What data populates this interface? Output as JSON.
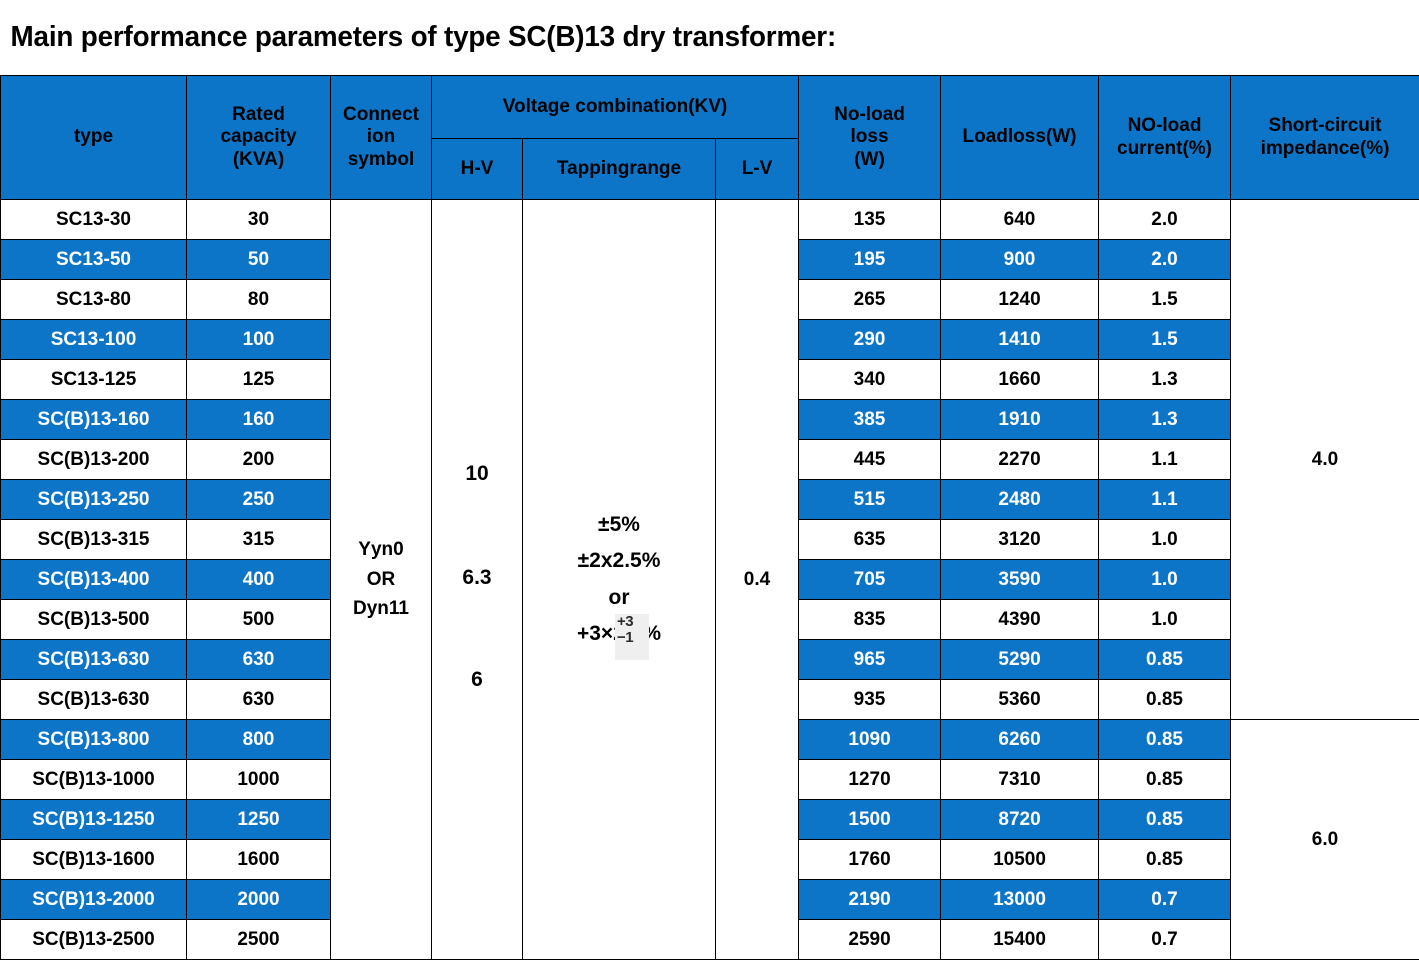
{
  "title": "Main performance parameters of type SC(B)13 dry transformer:",
  "colors": {
    "accent_blue": "#0C75C8",
    "text_dark": "#000000",
    "text_light": "#FFFFFF",
    "grid_line": "#000000",
    "marker_bg": "#EFEFEF"
  },
  "header": {
    "type": "type",
    "rated_capacity": "Rated capacity (KVA)",
    "rated_capacity_lines": [
      "Rated",
      "capacity",
      "(KVA)"
    ],
    "connection_symbol": "Connection symbol",
    "connection_symbol_lines": [
      "Connect",
      "ion",
      "symbol"
    ],
    "voltage_combination": "Voltage combination(KV)",
    "hv": "H-V",
    "tapping_range": "Tappingrange",
    "lv": "L-V",
    "no_load_loss": "No-load loss (W)",
    "no_load_loss_lines": [
      "No-load",
      "loss",
      "(W)"
    ],
    "load_loss": "Loadloss(W)",
    "no_load_current": "NO-load current(%)",
    "no_load_current_lines": [
      "NO-load",
      "current(%)"
    ],
    "short_circuit_impedance": "Short-circuit impedance(%)",
    "short_circuit_impedance_lines": [
      "Short-circuit",
      "impedance(%)"
    ]
  },
  "merged": {
    "connection_symbol_value": "Yyn0 OR Dyn11",
    "connection_symbol_value_lines": [
      "Yyn0",
      "OR",
      "Dyn11"
    ],
    "hv_values": [
      "10",
      "6.3",
      "6"
    ],
    "tapping_range_lines": [
      "±5%",
      "±2x2.5%",
      "or",
      "+3×2.5%"
    ],
    "tapping_marker_upper": "+3",
    "tapping_marker_lower": "−1",
    "lv_value": "0.4",
    "short_circuit_impedance_group_1": "4.0",
    "short_circuit_impedance_group_2": "6.0",
    "short_circuit_group_1_rows": 13,
    "short_circuit_group_2_rows": 7
  },
  "rows": [
    {
      "type": "SC13-30",
      "capacity": "30",
      "no_load_loss": "135",
      "load_loss": "640",
      "no_load_current": "2.0",
      "shaded": false
    },
    {
      "type": "SC13-50",
      "capacity": "50",
      "no_load_loss": "195",
      "load_loss": "900",
      "no_load_current": "2.0",
      "shaded": true
    },
    {
      "type": "SC13-80",
      "capacity": "80",
      "no_load_loss": "265",
      "load_loss": "1240",
      "no_load_current": "1.5",
      "shaded": false
    },
    {
      "type": "SC13-100",
      "capacity": "100",
      "no_load_loss": "290",
      "load_loss": "1410",
      "no_load_current": "1.5",
      "shaded": true
    },
    {
      "type": "SC13-125",
      "capacity": "125",
      "no_load_loss": "340",
      "load_loss": "1660",
      "no_load_current": "1.3",
      "shaded": false
    },
    {
      "type": "SC(B)13-160",
      "capacity": "160",
      "no_load_loss": "385",
      "load_loss": "1910",
      "no_load_current": "1.3",
      "shaded": true
    },
    {
      "type": "SC(B)13-200",
      "capacity": "200",
      "no_load_loss": "445",
      "load_loss": "2270",
      "no_load_current": "1.1",
      "shaded": false
    },
    {
      "type": "SC(B)13-250",
      "capacity": "250",
      "no_load_loss": "515",
      "load_loss": "2480",
      "no_load_current": "1.1",
      "shaded": true
    },
    {
      "type": "SC(B)13-315",
      "capacity": "315",
      "no_load_loss": "635",
      "load_loss": "3120",
      "no_load_current": "1.0",
      "shaded": false
    },
    {
      "type": "SC(B)13-400",
      "capacity": "400",
      "no_load_loss": "705",
      "load_loss": "3590",
      "no_load_current": "1.0",
      "shaded": true
    },
    {
      "type": "SC(B)13-500",
      "capacity": "500",
      "no_load_loss": "835",
      "load_loss": "4390",
      "no_load_current": "1.0",
      "shaded": false
    },
    {
      "type": "SC(B)13-630",
      "capacity": "630",
      "no_load_loss": "965",
      "load_loss": "5290",
      "no_load_current": "0.85",
      "shaded": true
    },
    {
      "type": "SC(B)13-630",
      "capacity": "630",
      "no_load_loss": "935",
      "load_loss": "5360",
      "no_load_current": "0.85",
      "shaded": false
    },
    {
      "type": "SC(B)13-800",
      "capacity": "800",
      "no_load_loss": "1090",
      "load_loss": "6260",
      "no_load_current": "0.85",
      "shaded": true
    },
    {
      "type": "SC(B)13-1000",
      "capacity": "1000",
      "no_load_loss": "1270",
      "load_loss": "7310",
      "no_load_current": "0.85",
      "shaded": false
    },
    {
      "type": "SC(B)13-1250",
      "capacity": "1250",
      "no_load_loss": "1500",
      "load_loss": "8720",
      "no_load_current": "0.85",
      "shaded": true
    },
    {
      "type": "SC(B)13-1600",
      "capacity": "1600",
      "no_load_loss": "1760",
      "load_loss": "10500",
      "no_load_current": "0.85",
      "shaded": false
    },
    {
      "type": "SC(B)13-2000",
      "capacity": "2000",
      "no_load_loss": "2190",
      "load_loss": "13000",
      "no_load_current": "0.7",
      "shaded": true
    },
    {
      "type": "SC(B)13-2500",
      "capacity": "2500",
      "no_load_loss": "2590",
      "load_loss": "15400",
      "no_load_current": "0.7",
      "shaded": false
    }
  ]
}
